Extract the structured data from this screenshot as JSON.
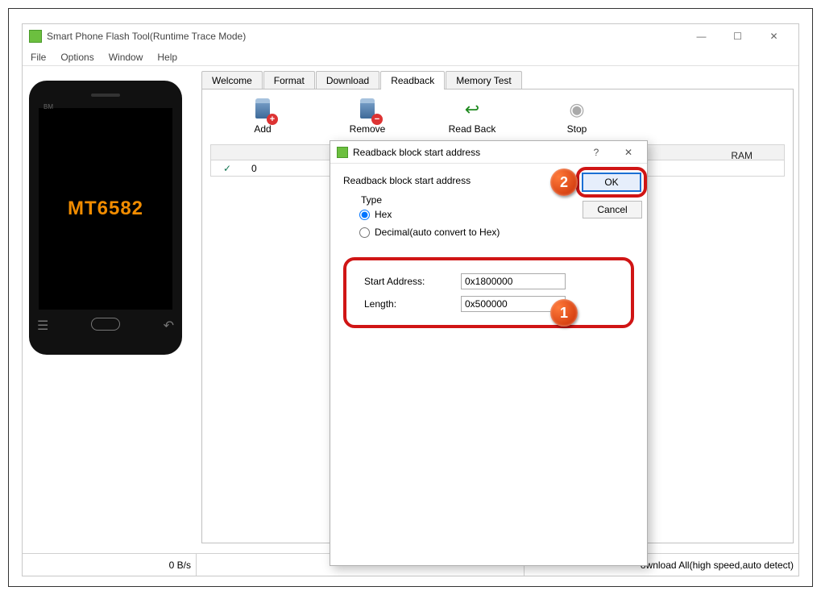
{
  "window": {
    "title": "Smart Phone Flash Tool(Runtime Trace Mode)",
    "min": "—",
    "max": "☐",
    "close": "✕"
  },
  "menus": [
    "File",
    "Options",
    "Window",
    "Help"
  ],
  "phone": {
    "bm": "BM",
    "model": "MT6582"
  },
  "tabs": [
    "Welcome",
    "Format",
    "Download",
    "Readback",
    "Memory Test"
  ],
  "active_tab": "Readback",
  "toolbar": {
    "add": "Add",
    "remove": "Remove",
    "readback": "Read Back",
    "stop": "Stop"
  },
  "table": {
    "row0_left": "0",
    "row0_region": "RAM",
    "check": "✓"
  },
  "status": {
    "speed": "0 B/s",
    "mode": "ownload All(high speed,auto detect)"
  },
  "dialog": {
    "title": "Readback block start address",
    "subhead": "Readback block start address",
    "type_label": "Type",
    "hex": "Hex",
    "dec": "Decimal(auto convert to Hex)",
    "start_label": "Start Address:",
    "start_val": "0x1800000",
    "len_label": "Length:",
    "len_val": "0x500000",
    "ok": "OK",
    "cancel": "Cancel",
    "help": "?",
    "close": "✕"
  },
  "badges": {
    "b1": "1",
    "b2": "2"
  }
}
